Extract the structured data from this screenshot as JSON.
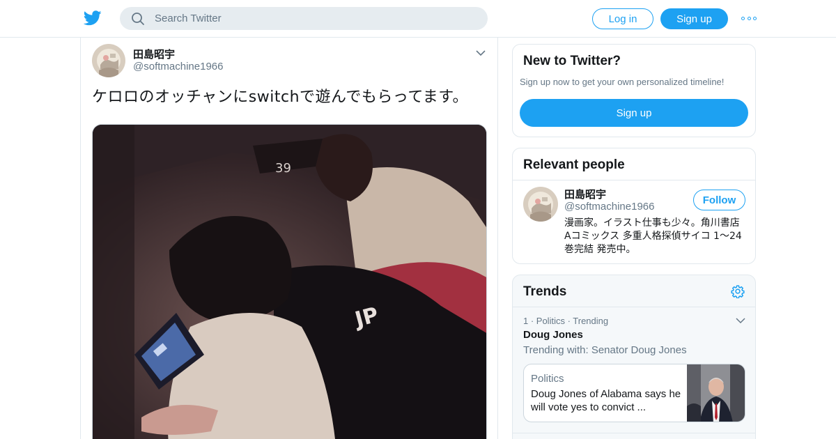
{
  "header": {
    "search_placeholder": "Search Twitter",
    "login_label": "Log in",
    "signup_label": "Sign up"
  },
  "tweet": {
    "author_name": "田島昭宇",
    "author_handle": "@softmachine1966",
    "text": "ケロロのオッチャンにswitchで遊んでもらってます。"
  },
  "new_to_twitter": {
    "title": "New to Twitter?",
    "subtitle": "Sign up now to get your own personalized timeline!",
    "button_label": "Sign up"
  },
  "relevant_people": {
    "title": "Relevant people",
    "person": {
      "name": "田島昭宇",
      "handle": "@softmachine1966",
      "follow_label": "Follow",
      "bio": "漫画家。イラスト仕事も少々。角川書店 Aコミックス 多重人格探偵サイコ 1〜24巻完結 発売中。"
    }
  },
  "trends": {
    "title": "Trends",
    "items": [
      {
        "meta": "1 · Politics · Trending",
        "name": "Doug Jones",
        "trending_with": "Trending with: Senator Doug Jones",
        "news": {
          "category": "Politics",
          "headline": "Doug Jones of Alabama says he will vote yes to convict ..."
        }
      }
    ]
  },
  "colors": {
    "brand": "#1da1f2",
    "text_primary": "#14171a",
    "text_secondary": "#657786",
    "border": "#e1e8ed"
  }
}
